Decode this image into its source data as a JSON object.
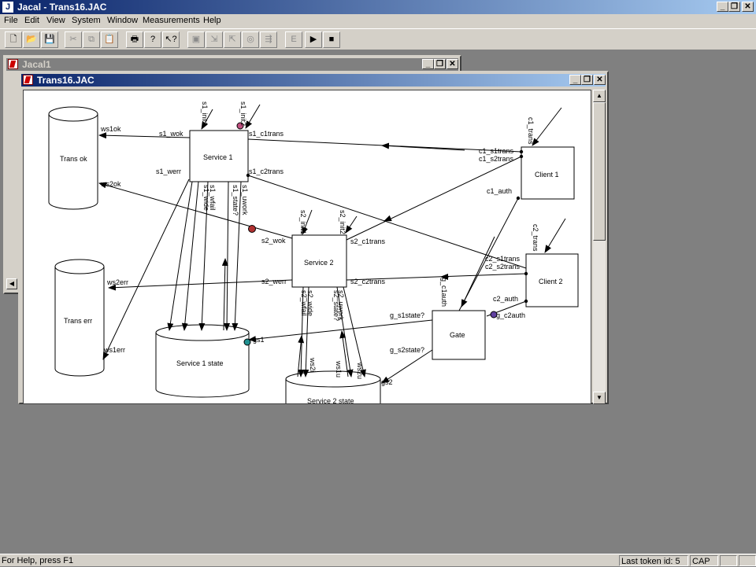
{
  "app": {
    "title": "Jacal - Trans16.JAC",
    "icon": "jacal-app-icon"
  },
  "window_controls": {
    "minimize": "_",
    "restore": "❐",
    "close": "✕"
  },
  "menu": [
    "File",
    "Edit",
    "View",
    "System",
    "Window",
    "Measurements",
    "Help"
  ],
  "toolbar": {
    "buttons": [
      "new-file-icon",
      "open-folder-icon",
      "save-disk-icon",
      "cut-icon",
      "copy-icon",
      "paste-icon",
      "print-icon",
      "context-help-icon",
      "tool-a-icon",
      "tool-b-icon",
      "tool-c-icon",
      "tool-d-icon",
      "tool-e-icon",
      "edit-mode-icon",
      "play-icon",
      "stop-icon"
    ],
    "edit_label": "E",
    "play_label": "▶",
    "stop_label": "■"
  },
  "bg_window": {
    "title": "Jacal1"
  },
  "doc_window": {
    "title": "Trans16.JAC"
  },
  "diagram": {
    "nodes": {
      "trans_ok": "Trans ok",
      "trans_err": "Trans err",
      "service1": "Service 1",
      "service2": "Service 2",
      "service1_state": "Service 1 state",
      "service2_state": "Service 2 state",
      "client1": "Client 1",
      "client2": "Client 2",
      "gate": "Gate"
    },
    "labels": {
      "ws1ok": "ws1ok",
      "ws2ok": "ws2ok",
      "ws2err": "ws2err",
      "ws1err": "ws1err",
      "s1_wok": "s1_wok",
      "s1_werr": "s1_werr",
      "s1_c1trans": "s1_c1trans",
      "s1_c2trans": "s1_c2trans",
      "s1_init1": "s1_init1",
      "s1_init2": "s1_init2",
      "s1_wfail": "s1_wfail",
      "s1_wide": "s1_wide",
      "s1_state": "s1_state?",
      "s1_uwork": "s1_uwork",
      "s2_wok": "s2_wok",
      "s2_werr": "s2_werr",
      "s2_c1trans": "s2_c1trans",
      "s2_c2trans": "s2_c2trans",
      "s2_init1": "s2_init1",
      "s2_init2": "s2_init2",
      "s2_wide": "s2_wide",
      "s2_wfail": "s2_wfail",
      "s2_uwork": "s2_uwork",
      "s2_state": "s2_state?",
      "c1_trans": "c1_trans",
      "c1_s1trans": "c1_s1trans",
      "c1_s2trans": "c1_s2trans",
      "c1_auth": "c1_auth",
      "c2_trans": "c2_trans",
      "c2_s1trans": "c2_s1trans",
      "c2_s2trans": "c2_s2trans",
      "c2_auth": "c2_auth",
      "g_c1auth": "g_c1auth",
      "g_c2auth": "g_c2auth",
      "g_s1state": "g_s1state?",
      "g_s2state": "g_s2state?",
      "gs1": "gs1",
      "gs2": "gs2",
      "ws2i": "ws2i",
      "ws2u": "ws2u",
      "ws1u": "ws1u"
    }
  },
  "status": {
    "help": "For Help, press F1",
    "token": "Last token id: 5",
    "cap": "CAP"
  }
}
